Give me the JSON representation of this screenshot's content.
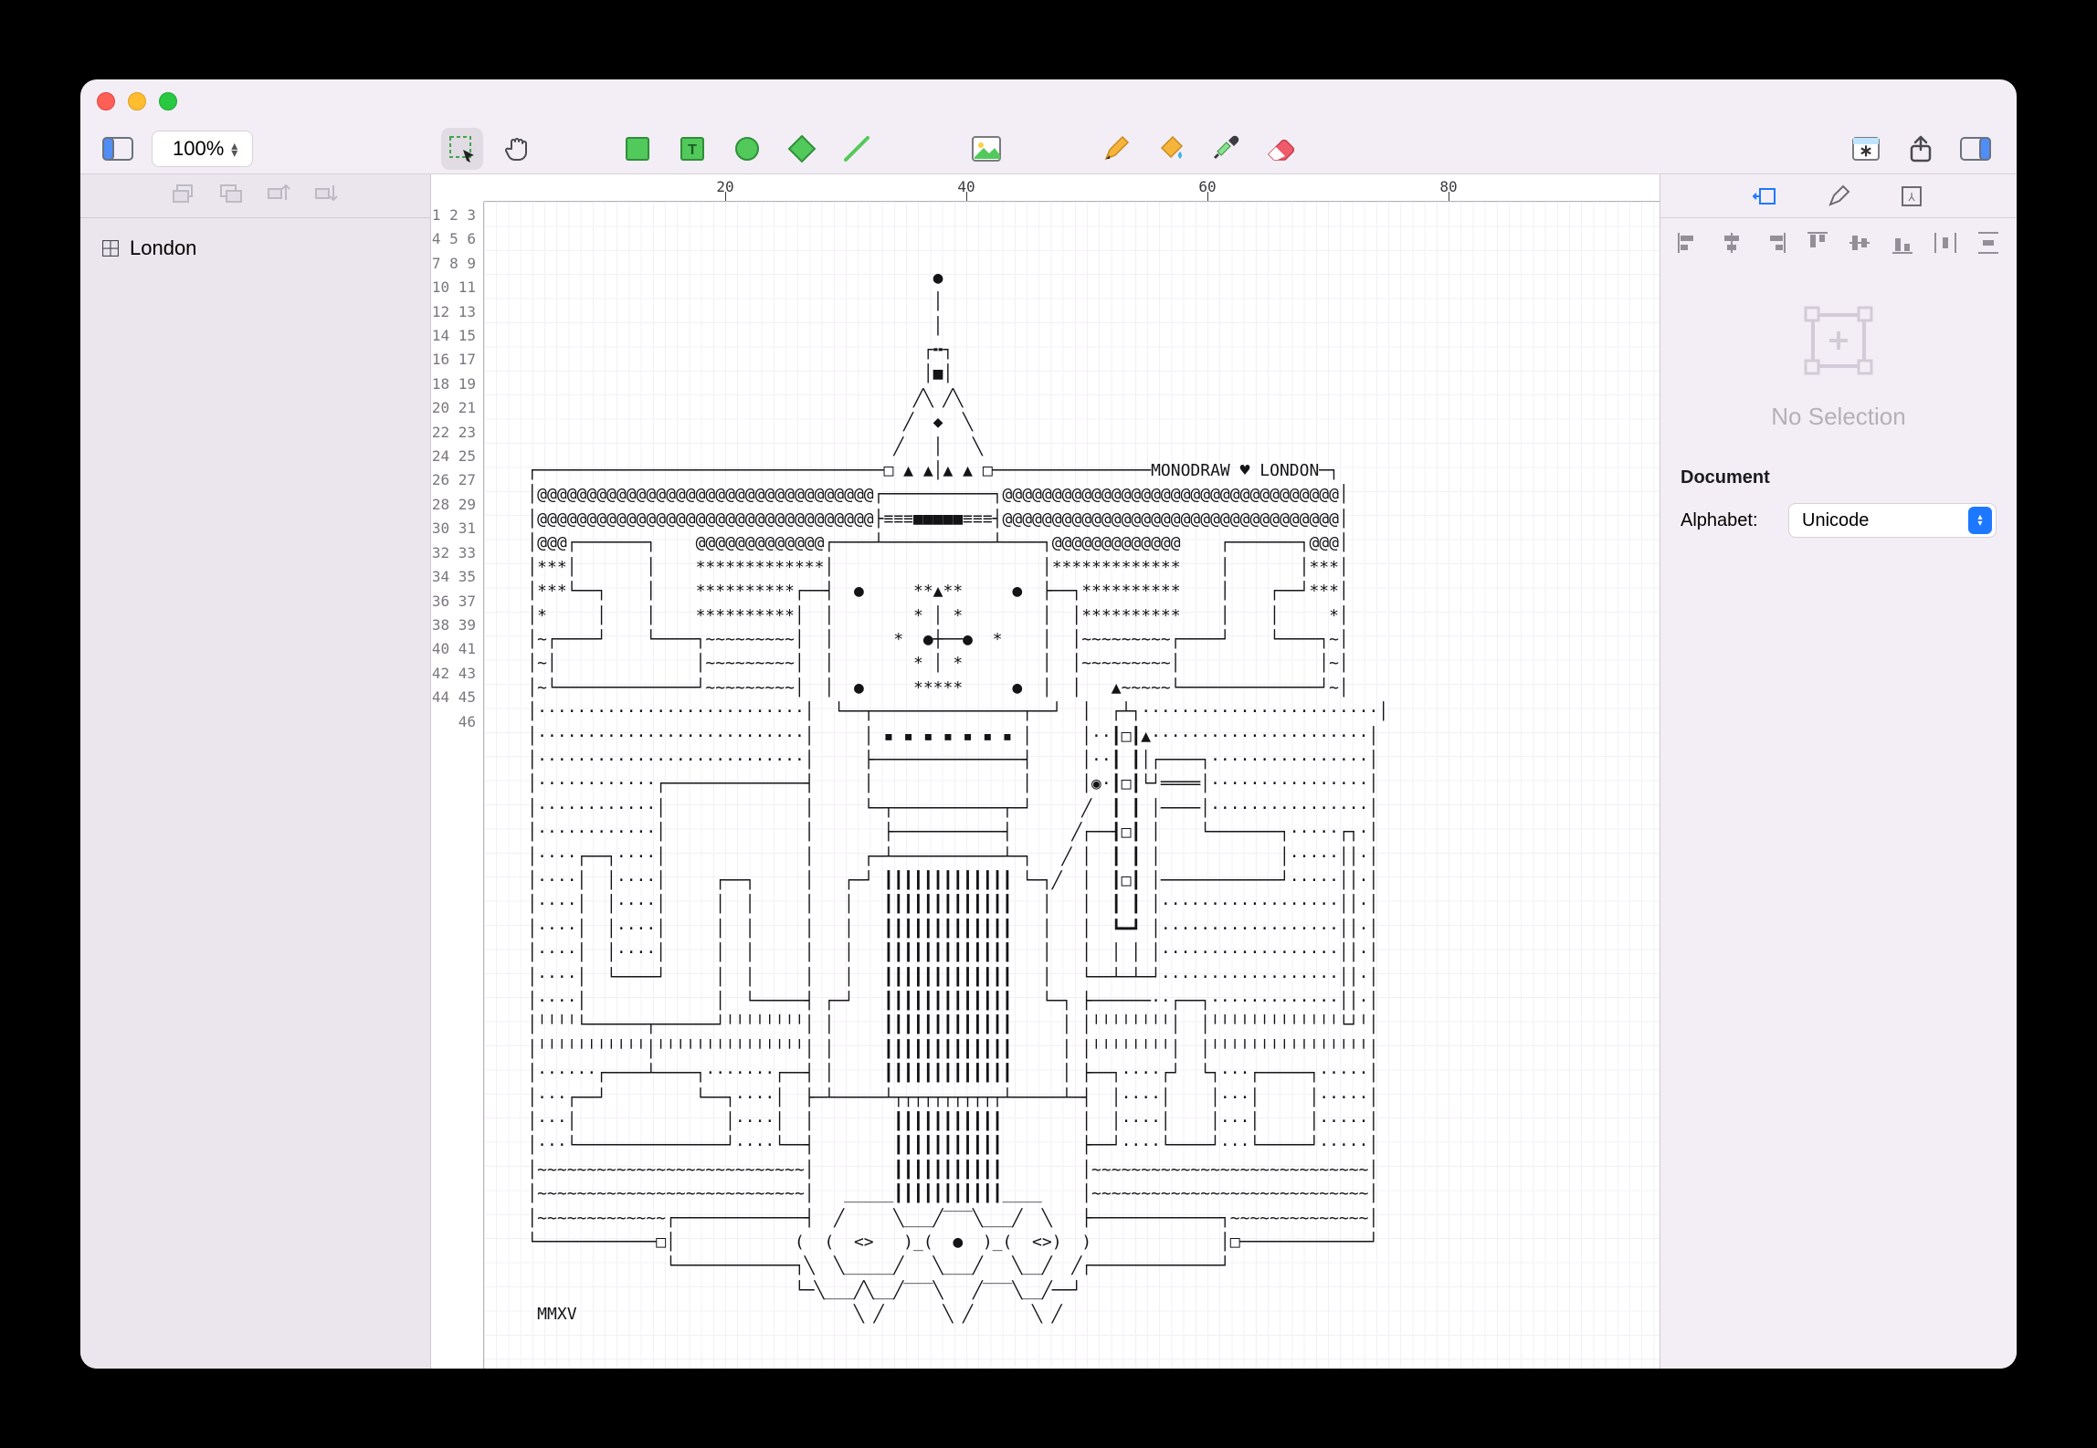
{
  "zoom": "100%",
  "ruler": {
    "marks": [
      20,
      40,
      60,
      80
    ]
  },
  "gutter": {
    "from": 1,
    "to": 46
  },
  "layers": [
    {
      "name": "London"
    }
  ],
  "inspector": {
    "no_selection": "No Selection",
    "doc_section": "Document",
    "alphabet_label": "Alphabet:",
    "alphabet_value": "Unicode"
  },
  "ascii": "\n\n                                             ●\n                                             │\n                                             │\n                                            ┌╍┐\n                                            │■│\n                                           ╱╲ ╱╲\n                                          ╱  ◆  ╲\n                                         ╱   │   ╲\n    ┌───────────────────────────────────□ ▲ ▲│▲ ▲ □────────────────MONODRAW ♥ LONDON─┐\n    │@@@@@@@@@@@@@@@@@​@@@@@@@@@@@@@@@@@┌───────────┐@@@@@@@@@@@@@@@@@@@@@@@@@@@@@@@@@@│\n    │@@@@@@@@@@@@@@@@@​@@@@@@@@@@@@@@@@@├≡≡≡■■■■■≡≡≡┤@@@@@@@@@@@@@@@@@@@@@@@@@@@@@@@@@@│\n    │@@@┌───────┐    @@@@@@@@@@@@@┌────┴───────────┴────┐@@@@@@@@@@@@@    ┌───────┐@@@│\n    │***│       │    *************│                     │*************    │       │***│\n    │***└──┐    │    **********┌──┤  ●     **▲**     ●  ├──┐**********    │    ┌──┘***│\n    │*     │    │    **********│  │        * │ *        │  │**********    │    │     *│\n    │~┌────┘    └────┐~~~~~~~~~│  │      *  ●┼──●  *    │  │~~~~~~~~~┌────┘    └────┐~│\n    │~│              │~~~~~~~~~│  │        * │ *        │  │~~~~~~~~~│              │~│\n    │~└──────────────┘~~~~~~~~~│  │  ●     *****     ●  │  │   ▲~~~~~└──────────────┘~│\n    │···························│  └──┬───────────────┬──┘  │  ┌┴┐························│\n    │···························│     │ ▪ ▪ ▪ ▪ ▪ ▪ ▪ │     │··┃□┃▲······················│\n    │···························│     ├───────────────┤     │··┃ ┃│┌────┐················│\n    │············┌──────────────┤     │               │     │◉·┃□┃└┘════│················│\n    │············│              │     └─┬───────────┬─┘     ╱  ┃ ┃ │────│················│\n    │············│              │       ├───────────┤      ╱┌──┨□┃ │    └───────┐·····┌┐·│\n    │····┌──┐····│              │     ┌─┴───────────┴─┐   ╱ │  ┃ ┃ │            │·····││·│\n    │····│  │····│     ┌──┐     │   ┌─┘ ┃┃┃┃┃┃┃┃┃┃┃┃┃ └─┐╱  │  ┃□┃ │────────────┘·····││·│\n    │····│  │····│     │  │     │   │   ┃┃┃┃┃┃┃┃┃┃┃┃┃   │   │  ┃ ┃ │··················││·│\n    │····│  │····│     │  │     │   │   ┃┃┃┃┃┃┃┃┃┃┃┃┃   │   │  ┗━┛ │··················││·│\n    │····│  │····│     │  │     │   │   ┃┃┃┃┃┃┃┃┃┃┃┃┃   │   │  │ │ │··················││·│\n    │····│  └────┘     │  │     │   │   ┃┃┃┃┃┃┃┃┃┃┃┃┃   │   └──┴─┴─┘··················││·│\n    │····│             │  └─────┤ ┌─┘   ┃┃┃┃┃┃┃┃┃┃┃┃┃   └─┐ ├──────··┌──┐·············││·│\n    │╵╵╵╵└──────┬──────┘╵╵╵╵╵╵╵╵│ │     ┃┃┃┃┃┃┃┃┃┃┃┃┃     │ │╵╵╵╵╵╵╵╵│  │╵╵╵╵╵╵╵╵╵╵╵╵╵└┘╵│\n    │╵╵╵╵╵╵╵╵╵╵╵│╵╵╵╵╵╵╵╵╵╵╵╵╵╵╵│ │     ┃┃┃┃┃┃┃┃┃┃┃┃┃     │ │╵╵╵╵╵╵╵╵│  │╵╵╵╵╵╵╵╵╵╵╵╵╵╵╵╵│\n    │······┌────┴────┐·······┌──┤ │     ┃┃┃┃┃┃┃┃┃┃┃┃┃     │ ├──┐····┌┘  └┐···┌─────┐·····│\n    │···┌──┘         └──┐····│  ├─┴─────┴┬┬┬┬┬┬┬┬┬┬┬┴─────┴─┤  │····│    │···│     │·····│\n    │···│               │····│  │        ┃┃┃┃┃┃┃┃┃┃┃        │  │····│    │···│     │·····│\n    │···└───────────────┘····└──┤        ┃┃┃┃┃┃┃┃┃┃┃        ├──┘····└────┘···└─────┘·····│\n    │~~~~~~~~~~~~~~~~~~~~~~~~~~~│        ┃┃┃┃┃┃┃┃┃┃┃        │~~~~~~~~~~~~~~~~~~~~~~~~~~~~│\n    │~~~~~~~~~~~~~~~~~~~~~~~~~~~│   _____┃┃┃┃┃┃┃┃┃┃┃____    │~~~~~~~~~~~~~~~~~~~~~~~~~~~~│\n    │~~~~~~~~~~~~~┌─────────────┤  ╱     ╲___╱‾‾‾╲___╱  ╲   ├─────────────┐~~~~~~~~~~~~~~│\n    └────────────□│            (  (  <>   )_(  ●  )_(  <>)  )             │□─────────────┘\n                  └────────────┐╲  ╲_____╱   ╲___╱   ╲__╱  ╱┌─────────────┘\n                               └─╲___╱╲__╱‾‾‾╲   ╱‾‾‾╲__╱──┘\n     MMXV                            ╲ ╱      ╲ ╱      ╲ ╱\n"
}
